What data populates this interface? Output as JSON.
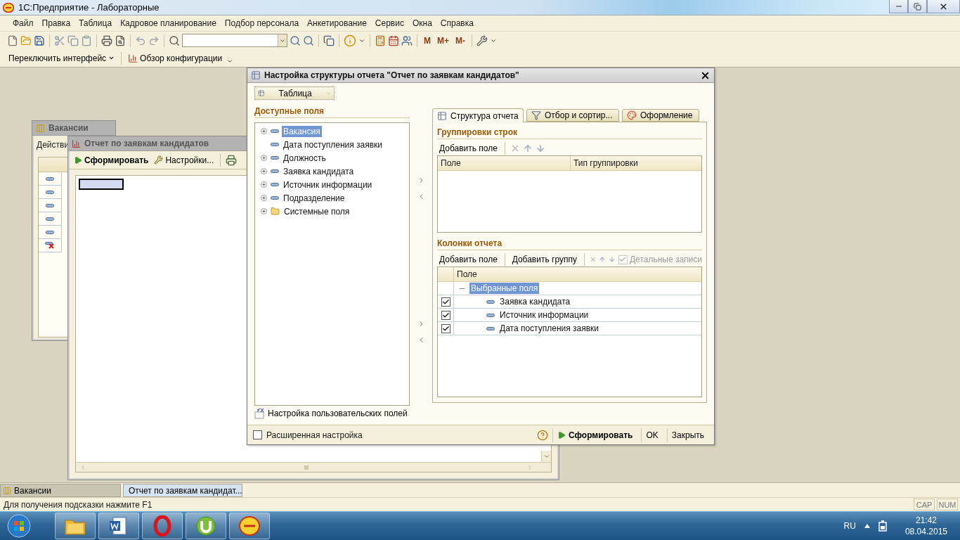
{
  "window": {
    "title": "1С:Предприятие - Лабораторные"
  },
  "menu": [
    {
      "label": "Файл"
    },
    {
      "label": "Правка"
    },
    {
      "label": "Таблица"
    },
    {
      "label": "Кадровое планирование"
    },
    {
      "label": "Подбор персонала"
    },
    {
      "label": "Анкетирование"
    },
    {
      "label": "Сервис"
    },
    {
      "label": "Окна"
    },
    {
      "label": "Справка"
    }
  ],
  "memory_buttons": [
    "M",
    "M+",
    "M-"
  ],
  "interface_bar": {
    "switch_label": "Переключить интерфейс",
    "config_label": "Обзор конфигурации"
  },
  "vacancies_window": {
    "title": "Вакансии",
    "action_label": "Действи",
    "rows": [
      {
        "kind": "item"
      },
      {
        "kind": "item"
      },
      {
        "kind": "item"
      },
      {
        "kind": "item"
      },
      {
        "kind": "item"
      },
      {
        "kind": "deleted"
      }
    ]
  },
  "report_window": {
    "title": "Отчет по заявкам кандидатов",
    "toolbar": [
      {
        "label": "Сформировать",
        "kind": "run"
      },
      {
        "label": "Настройки...",
        "kind": "settings"
      }
    ]
  },
  "dialog": {
    "title": "Настройка структуры отчета \"Отчет по заявкам кандидатов\"",
    "view_button": "Таблица",
    "available_title": "Доступные поля",
    "available_fields": [
      {
        "label": "Вакансия",
        "kind": "field",
        "has_children": true,
        "selected": true
      },
      {
        "label": "Дата поступления заявки",
        "kind": "field",
        "has_children": false,
        "selected": false
      },
      {
        "label": "Должность",
        "kind": "field",
        "has_children": true,
        "selected": false
      },
      {
        "label": "Заявка кандидата",
        "kind": "field",
        "has_children": true,
        "selected": false
      },
      {
        "label": "Источник информации",
        "kind": "field",
        "has_children": true,
        "selected": false
      },
      {
        "label": "Подразделение",
        "kind": "field",
        "has_children": true,
        "selected": false
      },
      {
        "label": "Системные поля",
        "kind": "folder",
        "has_children": true,
        "selected": false
      }
    ],
    "custom_fields_link": "Настройка пользовательских полей",
    "tabs": [
      {
        "label": "Структура отчета",
        "kind": "structure",
        "selected": true
      },
      {
        "label": "Отбор и сортир...",
        "kind": "filter",
        "selected": false
      },
      {
        "label": "Оформление",
        "kind": "design",
        "selected": false
      }
    ],
    "groupings": {
      "title": "Группировки строк",
      "add_label": "Добавить поле",
      "columns": [
        "Поле",
        "Тип группировки"
      ]
    },
    "report_columns": {
      "title": "Колонки отчета",
      "add_field_label": "Добавить поле",
      "add_group_label": "Добавить группу",
      "detail": {
        "label": "Детальные записи",
        "checked": true,
        "disabled": true
      },
      "column": "Поле",
      "tree": [
        {
          "label": "Выбранные поля",
          "expanded": true,
          "selected": true,
          "children": [
            {
              "label": "Заявка кандидата",
              "checked": true
            },
            {
              "label": "Источник информации",
              "checked": true
            },
            {
              "label": "Дата поступления заявки",
              "checked": true
            }
          ]
        }
      ]
    },
    "advanced": {
      "label": "Расширенная настройка",
      "checked": false
    },
    "buttons": [
      {
        "label": "Сформировать",
        "kind": "run"
      },
      {
        "label": "OK",
        "kind": "plain"
      },
      {
        "label": "Закрыть",
        "kind": "plain"
      }
    ]
  },
  "window_tabs": [
    {
      "label": "Вакансии",
      "kind": "list",
      "selected": false
    },
    {
      "label": "Отчет по заявкам кандидат...",
      "kind": "report",
      "selected": true
    }
  ],
  "status_bar": {
    "hint": "Для получения подсказки нажмите F1",
    "indicators": [
      "CAP",
      "NUM"
    ]
  },
  "taskbar": {
    "apps": [
      {
        "kind": "folder"
      },
      {
        "kind": "document"
      },
      {
        "kind": "ring"
      },
      {
        "kind": "leaf"
      },
      {
        "kind": "disc"
      }
    ],
    "language": "RU",
    "time": "21:42",
    "date": "08.04.2015"
  }
}
